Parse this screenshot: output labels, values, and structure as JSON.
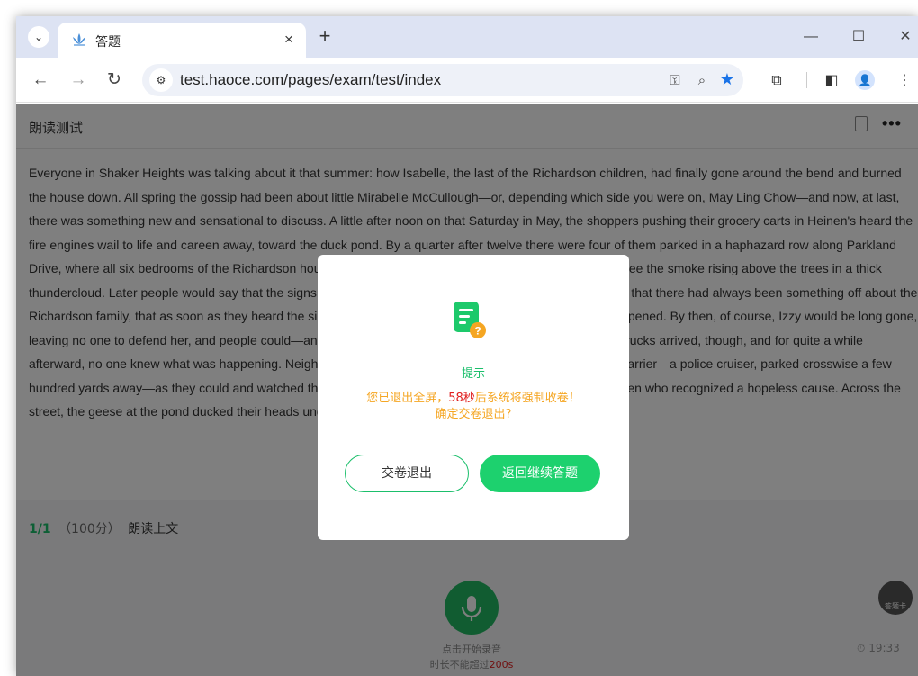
{
  "browser": {
    "tab": {
      "title": "答题",
      "close_glyph": "×",
      "favicon": "lotus-icon"
    },
    "tab_list_glyph": "⌄",
    "new_tab_glyph": "+",
    "window_controls": {
      "minimize": "—",
      "maximize": "☐",
      "close": "✕"
    },
    "nav": {
      "back": "←",
      "forward": "→",
      "reload": "↻"
    },
    "url": "test.haoce.com/pages/exam/test/index",
    "site_info_glyph": "⚙",
    "omnibox_icons": {
      "password": "⚿",
      "zoom": "⌕",
      "bookmark": "★"
    },
    "toolbar_icons": {
      "extensions": "⧉",
      "side_panel": "◧",
      "profile": "👤",
      "menu": "⋮"
    },
    "accent": "#1a73e8"
  },
  "page": {
    "title": "朗读测试",
    "more_glyph": "•••",
    "passage": "Everyone in Shaker Heights was talking about it that summer: how Isabelle, the last of the Richardson children, had finally gone around the bend and burned the house down. All spring the gossip had been about little Mirabelle McCullough—or, depending which side you were on, May Ling Chow—and now, at last, there was something new and sensational to discuss. A little after noon on that Saturday in May, the shoppers pushing their grocery carts in Heinen's heard the fire engines wail to life and careen away, toward the duck pond. By a quarter after twelve there were four of them parked in a haphazard row along Parkland Drive, where all six bedrooms of the Richardson house were ablaze, and everyone within a half mile could see the smoke rising above the trees in a thick thundercloud. Later people would say that the signs had been there all along: that Izzy was a loose cannon, that there had always been something off about the Richardson family, that as soon as they heard the sirens that morning they knew something terrible had happened. By then, of course, Izzy would be long gone, leaving no one to defend her, and people could—and did—say whatever they liked. At the moment the fire trucks arrived, though, and for quite a while afterward, no one knew what was happening. Neighbors clustered as close as they could to the makeshift barrier—a police cruiser, parked crosswise a few hundred yards away—as they could and watched the firemen unreeling their hoses with the grim faces of men who recognized a hopeless cause. Across the street, the geese at the pond ducked their heads underwater for weeds, totally unruffled by the commotion.",
    "question": {
      "index": "1/1",
      "score": "（100分）",
      "label": "朗读上文"
    },
    "record": {
      "caption_line1": "点击开始录音",
      "caption_prefix": "时长不能超过",
      "caption_limit": "200s"
    },
    "answer_card_label": "答题卡",
    "timer": "19:33"
  },
  "modal": {
    "title": "提示",
    "msg_prefix": "您已退出全屏，",
    "msg_seconds": "58秒",
    "msg_suffix": "后系统将强制收卷！",
    "msg_line2": "确定交卷退出?",
    "quit_button": "交卷退出",
    "back_button": "返回继续答题",
    "colors": {
      "green": "#1bbf6b",
      "orange": "#f5a623",
      "red": "#e02020"
    }
  }
}
